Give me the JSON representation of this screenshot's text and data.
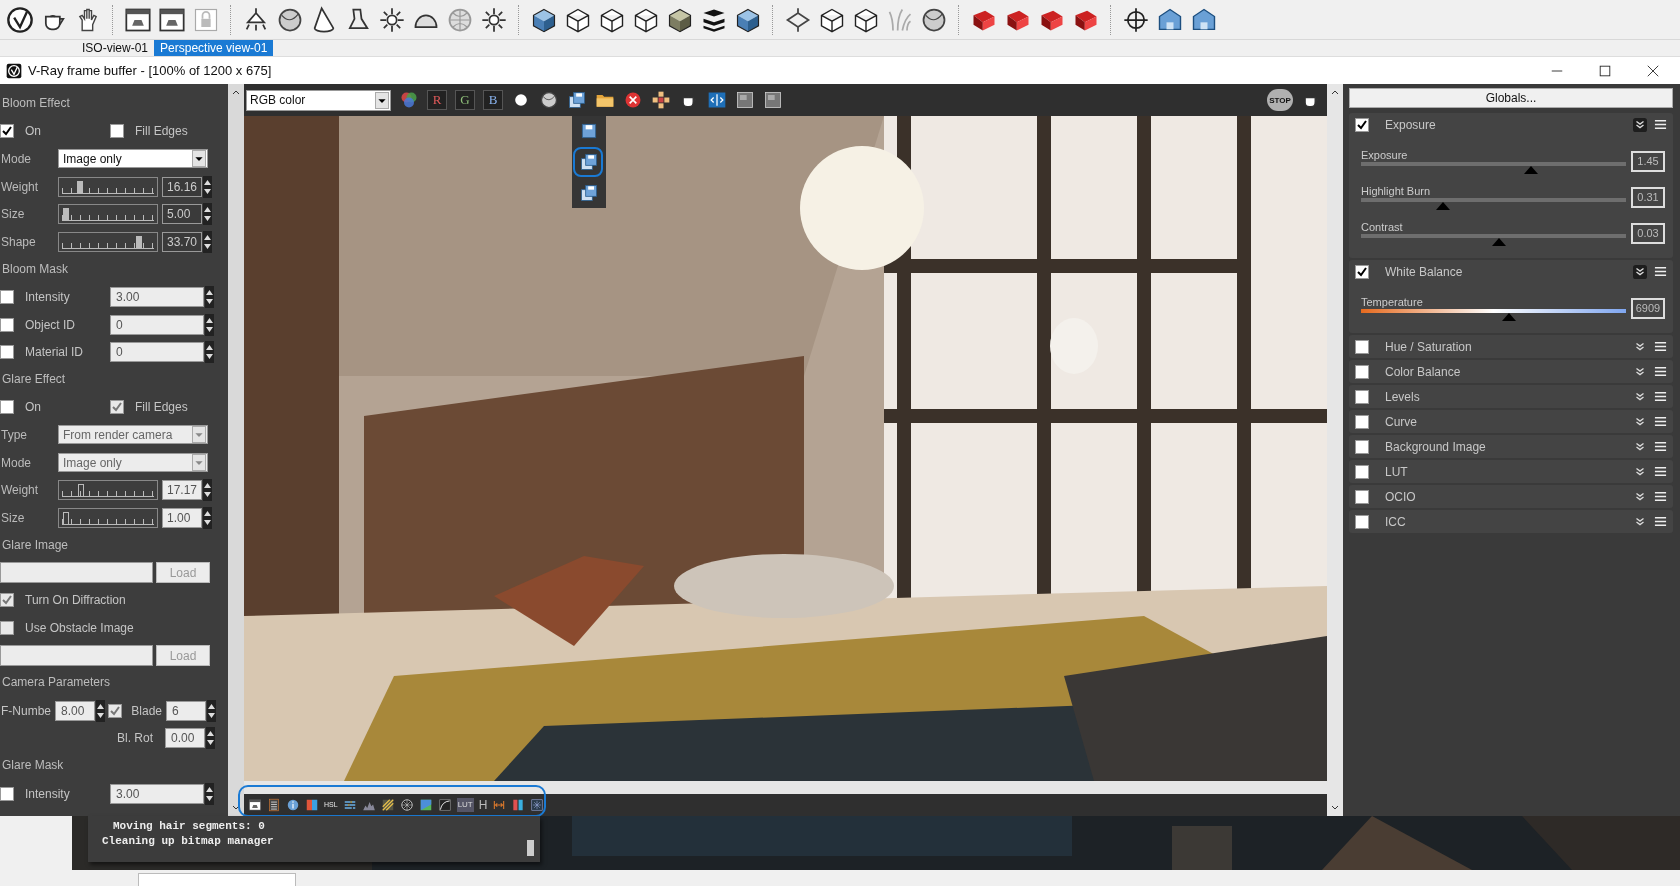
{
  "toolbar": {
    "tabs": [
      {
        "label": "ISO-view-01",
        "selected": false
      },
      {
        "label": "Perspective view-01",
        "selected": true
      }
    ]
  },
  "window": {
    "title": "V-Ray frame buffer - [100% of 1200 x 675]"
  },
  "render_toolbar": {
    "channel": "RGB color",
    "channel_buttons": [
      "R",
      "G",
      "B"
    ],
    "stop": "STOP"
  },
  "left_panel": {
    "bloom_effect": {
      "title": "Bloom Effect",
      "on": {
        "label": "On",
        "checked": true
      },
      "fill_edges": {
        "label": "Fill Edges",
        "checked": false
      },
      "mode": {
        "label": "Mode",
        "value": "Image only",
        "disabled": false
      },
      "sliders": [
        {
          "label": "Weight",
          "level": 0.17,
          "value": "16.16"
        },
        {
          "label": "Size",
          "level": 0.02,
          "value": "5.00"
        },
        {
          "label": "Shape",
          "level": 0.82,
          "value": "33.70"
        }
      ]
    },
    "bloom_mask": {
      "title": "Bloom Mask",
      "rows": [
        {
          "label": "Intensity",
          "checked": false,
          "value": "3.00"
        },
        {
          "label": "Object ID",
          "checked": false,
          "value": "0"
        },
        {
          "label": "Material ID",
          "checked": false,
          "value": "0"
        }
      ]
    },
    "glare_effect": {
      "title": "Glare Effect",
      "on": {
        "label": "On",
        "checked": false
      },
      "fill_edges": {
        "label": "Fill Edges",
        "checked": true
      },
      "type": {
        "label": "Type",
        "value": "From render camera",
        "disabled": true
      },
      "mode": {
        "label": "Mode",
        "value": "Image only",
        "disabled": true
      },
      "sliders": [
        {
          "label": "Weight",
          "level": 0.18,
          "value": "17.17"
        },
        {
          "label": "Size",
          "level": 0.02,
          "value": "1.00"
        }
      ]
    },
    "glare_image": {
      "title": "Glare Image",
      "button": "Load"
    },
    "diffraction": {
      "label": "Turn On Diffraction",
      "checked": true
    },
    "obstacle": {
      "label": "Use Obstacle Image",
      "checked": false,
      "button": "Load"
    },
    "camera_parameters": {
      "title": "Camera Parameters",
      "f_number": {
        "label": "F-Numbe",
        "value": "8.00"
      },
      "blade": {
        "label": "Blade",
        "checked": true,
        "value": "6"
      },
      "blade_rotation": {
        "label": "Bl. Rot",
        "value": "0.00"
      }
    },
    "glare_mask": {
      "title": "Glare Mask",
      "rows": [
        {
          "label": "Intensity",
          "checked": false,
          "value": "3.00"
        }
      ]
    }
  },
  "right_panel": {
    "button": "Globals...",
    "layers": [
      {
        "name": "Exposure",
        "checked": true,
        "expanded": true,
        "sliders": [
          {
            "label": "Exposure",
            "kind": "plain",
            "level": 0.64,
            "value": "1.45"
          },
          {
            "label": "Highlight Burn",
            "kind": "plain",
            "level": 0.31,
            "value": "0.31"
          },
          {
            "label": "Contrast",
            "kind": "plain",
            "level": 0.52,
            "value": "0.03"
          }
        ]
      },
      {
        "name": "White Balance",
        "checked": true,
        "expanded": true,
        "sliders": [
          {
            "label": "Temperature",
            "kind": "temperature",
            "level": 0.56,
            "value": "6909"
          }
        ]
      },
      {
        "name": "Hue / Saturation",
        "checked": false,
        "expanded": false
      },
      {
        "name": "Color Balance",
        "checked": false,
        "expanded": false
      },
      {
        "name": "Levels",
        "checked": false,
        "expanded": false
      },
      {
        "name": "Curve",
        "checked": false,
        "expanded": false
      },
      {
        "name": "Background Image",
        "checked": false,
        "expanded": false
      },
      {
        "name": "LUT",
        "checked": false,
        "expanded": false
      },
      {
        "name": "OCIO",
        "checked": false,
        "expanded": false
      },
      {
        "name": "ICC",
        "checked": false,
        "expanded": false
      }
    ]
  },
  "bottom_toolbar": {
    "hsl": "HSL",
    "lut": "LUT",
    "h": "H"
  },
  "console": {
    "lines": [
      "Moving hair segments: 0",
      "Cleaning up bitmap manager"
    ]
  }
}
